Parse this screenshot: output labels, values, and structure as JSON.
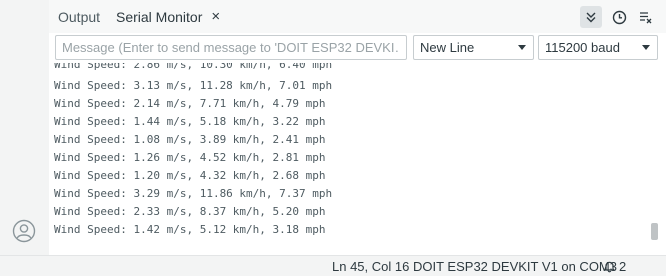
{
  "tabs": [
    {
      "label": "Output"
    },
    {
      "label": "Serial Monitor",
      "close": "×"
    }
  ],
  "toolbar": {
    "autoscroll_icon": "chevrons-down-icon",
    "timestamp_icon": "clock-icon",
    "clear_icon": "clear-output-icon"
  },
  "message": {
    "placeholder": "Message (Enter to send message to 'DOIT ESP32 DEVKI…",
    "value": ""
  },
  "line_ending": {
    "selected": "New Line"
  },
  "baud_rate": {
    "selected": "115200 baud"
  },
  "console": {
    "lines": [
      "Wind Speed: 2.86 m/s, 10.30 km/h, 6.40 mph",
      "Wind Speed: 3.13 m/s, 11.28 km/h, 7.01 mph",
      "Wind Speed: 2.14 m/s, 7.71 km/h, 4.79 mph",
      "Wind Speed: 1.44 m/s, 5.18 km/h, 3.22 mph",
      "Wind Speed: 1.08 m/s, 3.89 km/h, 2.41 mph",
      "Wind Speed: 1.26 m/s, 4.52 km/h, 2.81 mph",
      "Wind Speed: 1.20 m/s, 4.32 km/h, 2.68 mph",
      "Wind Speed: 3.29 m/s, 11.86 km/h, 7.37 mph",
      "Wind Speed: 2.33 m/s, 8.37 km/h, 5.20 mph",
      "Wind Speed: 1.42 m/s, 5.12 km/h, 3.18 mph"
    ]
  },
  "status": {
    "position": "Ln 45, Col 16",
    "board": "DOIT ESP32 DEVKIT V1 on COM3",
    "notifications": "2"
  },
  "colors": {
    "accent": "#4e5b61",
    "selected_tool_bg": "#dfe3e5"
  }
}
